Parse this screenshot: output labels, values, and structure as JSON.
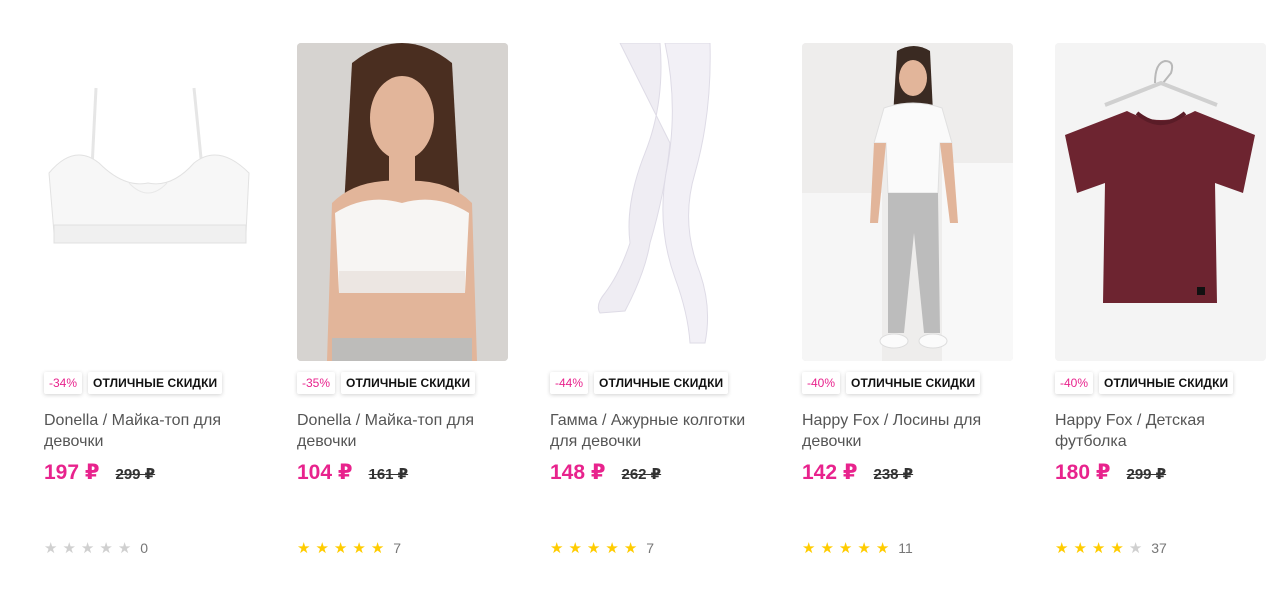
{
  "products": [
    {
      "discount": "-34%",
      "tag": "ОТЛИЧНЫЕ СКИДКИ",
      "title": "Donella / Майка-топ для девочки",
      "price": "197 ₽",
      "old_price": "299 ₽",
      "rating": 0,
      "reviews": "0",
      "image": "white-bra-top"
    },
    {
      "discount": "-35%",
      "tag": "ОТЛИЧНЫЕ СКИДКИ",
      "title": "Donella / Майка-топ для девочки",
      "price": "104 ₽",
      "old_price": "161 ₽",
      "rating": 5,
      "reviews": "7",
      "image": "girl-in-white-top"
    },
    {
      "discount": "-44%",
      "tag": "ОТЛИЧНЫЕ СКИДКИ",
      "title": "Гамма / Ажурные колготки для девочки",
      "price": "148 ₽",
      "old_price": "262 ₽",
      "rating": 5,
      "reviews": "7",
      "image": "white-tights-legs"
    },
    {
      "discount": "-40%",
      "tag": "ОТЛИЧНЫЕ СКИДКИ",
      "title": "Happy Fox / Лосины для девочки",
      "price": "142 ₽",
      "old_price": "238 ₽",
      "rating": 5,
      "reviews": "11",
      "image": "girl-in-grey-leggings"
    },
    {
      "discount": "-40%",
      "tag": "ОТЛИЧНЫЕ СКИДКИ",
      "title": "Happy Fox / Детская футболка",
      "price": "180 ₽",
      "old_price": "299 ₽",
      "rating": 4,
      "reviews": "37",
      "image": "burgundy-tshirt-on-hanger"
    }
  ],
  "colors": {
    "accent": "#e8238d",
    "star_on": "#ffcc00",
    "star_off": "#d0d0d0"
  }
}
